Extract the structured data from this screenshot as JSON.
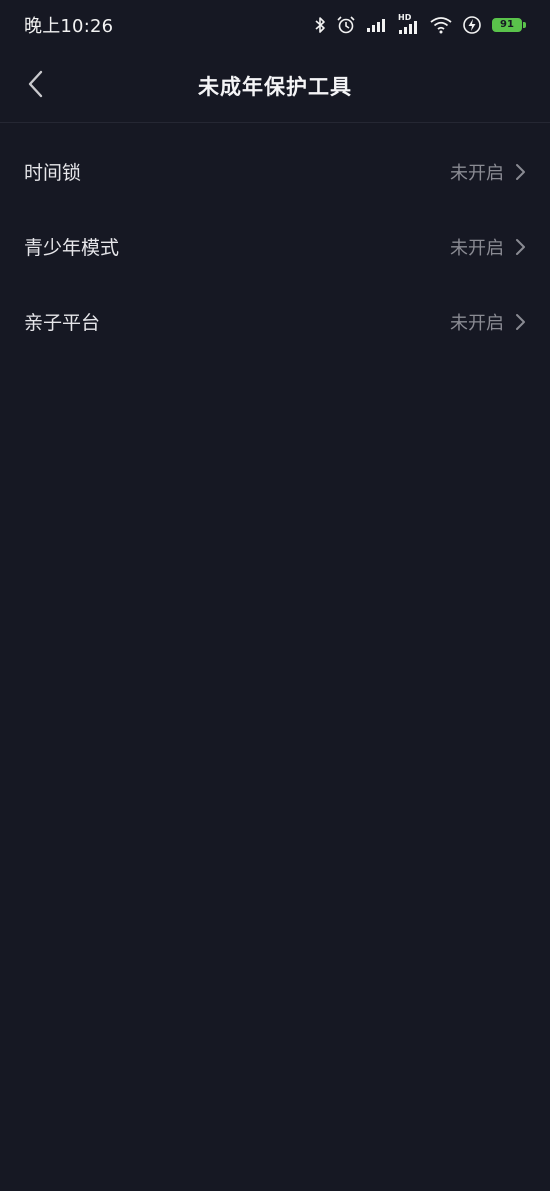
{
  "status_bar": {
    "time": "晚上10:26",
    "network_label": "HD",
    "battery_level": "91",
    "battery_color": "#5ac34b",
    "icons": [
      "bluetooth-icon",
      "alarm-icon",
      "signal-icon",
      "signal-hd-icon",
      "wifi-icon",
      "charging-icon",
      "battery-icon"
    ]
  },
  "nav": {
    "back_icon": "chevron-left-icon",
    "title": "未成年保护工具"
  },
  "list": {
    "items": [
      {
        "label": "时间锁",
        "status": "未开启",
        "icon": "chevron-right-icon"
      },
      {
        "label": "青少年模式",
        "status": "未开启",
        "icon": "chevron-right-icon"
      },
      {
        "label": "亲子平台",
        "status": "未开启",
        "icon": "chevron-right-icon"
      }
    ]
  },
  "colors": {
    "background": "#161823",
    "text_primary": "#e6e6ea",
    "text_secondary": "#8a8b93",
    "divider": "#252733"
  }
}
